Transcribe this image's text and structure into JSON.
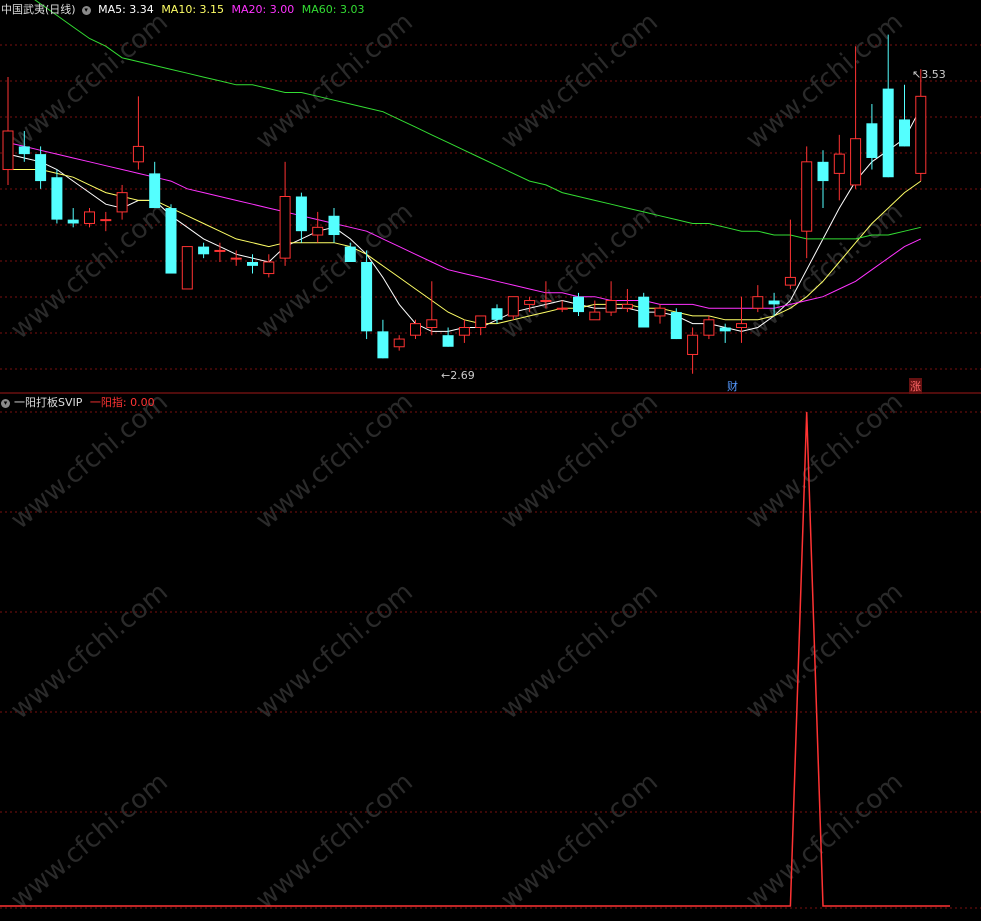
{
  "main_header": {
    "title": "中国武夷(日线)",
    "ma": [
      {
        "label": "MA5: 3.34",
        "color": "#ffffff"
      },
      {
        "label": "MA10: 3.15",
        "color": "#ffff66"
      },
      {
        "label": "MA20: 3.00",
        "color": "#ff33ff"
      },
      {
        "label": "MA60: 3.03",
        "color": "#33dd33"
      }
    ]
  },
  "sub_header": {
    "title": "一阳打板SVIP",
    "indicator": "一阳指: 0.00"
  },
  "annotations": {
    "high": "3.53",
    "low": "2.69",
    "event_cai": "财",
    "event_zhang": "涨"
  },
  "watermark": "www.cfchi.com",
  "colors": {
    "up": "#ff3333",
    "down": "#54ffff",
    "grid": "#7a1010",
    "ma5": "#ffffff",
    "ma10": "#ffff66",
    "ma20": "#ff33ff",
    "ma60": "#33dd33",
    "indicator": "#ff3333"
  },
  "chart_data": [
    {
      "type": "candlestick",
      "ylim": [
        2.6,
        3.62
      ],
      "candles": [
        {
          "o": 3.18,
          "h": 3.42,
          "l": 3.14,
          "c": 3.28
        },
        {
          "o": 3.24,
          "h": 3.28,
          "l": 3.2,
          "c": 3.22
        },
        {
          "o": 3.22,
          "h": 3.24,
          "l": 3.13,
          "c": 3.15
        },
        {
          "o": 3.16,
          "h": 3.18,
          "l": 3.04,
          "c": 3.05
        },
        {
          "o": 3.05,
          "h": 3.08,
          "l": 3.03,
          "c": 3.04
        },
        {
          "o": 3.04,
          "h": 3.08,
          "l": 3.03,
          "c": 3.07
        },
        {
          "o": 3.05,
          "h": 3.07,
          "l": 3.02,
          "c": 3.05
        },
        {
          "o": 3.07,
          "h": 3.14,
          "l": 3.05,
          "c": 3.12
        },
        {
          "o": 3.2,
          "h": 3.37,
          "l": 3.18,
          "c": 3.24
        },
        {
          "o": 3.17,
          "h": 3.2,
          "l": 3.08,
          "c": 3.08
        },
        {
          "o": 3.08,
          "h": 3.09,
          "l": 2.91,
          "c": 2.91
        },
        {
          "o": 2.87,
          "h": 2.98,
          "l": 2.87,
          "c": 2.98
        },
        {
          "o": 2.98,
          "h": 2.99,
          "l": 2.95,
          "c": 2.96
        },
        {
          "o": 2.97,
          "h": 2.99,
          "l": 2.94,
          "c": 2.97
        },
        {
          "o": 2.95,
          "h": 2.97,
          "l": 2.93,
          "c": 2.95
        },
        {
          "o": 2.94,
          "h": 2.96,
          "l": 2.91,
          "c": 2.93
        },
        {
          "o": 2.91,
          "h": 2.96,
          "l": 2.9,
          "c": 2.94
        },
        {
          "o": 2.95,
          "h": 3.2,
          "l": 2.93,
          "c": 3.11
        },
        {
          "o": 3.11,
          "h": 3.12,
          "l": 2.99,
          "c": 3.02
        },
        {
          "o": 3.01,
          "h": 3.07,
          "l": 2.99,
          "c": 3.03
        },
        {
          "o": 3.06,
          "h": 3.08,
          "l": 2.99,
          "c": 3.01
        },
        {
          "o": 2.98,
          "h": 2.99,
          "l": 2.94,
          "c": 2.94
        },
        {
          "o": 2.94,
          "h": 2.97,
          "l": 2.74,
          "c": 2.76
        },
        {
          "o": 2.76,
          "h": 2.79,
          "l": 2.69,
          "c": 2.69
        },
        {
          "o": 2.72,
          "h": 2.75,
          "l": 2.71,
          "c": 2.74
        },
        {
          "o": 2.75,
          "h": 2.79,
          "l": 2.74,
          "c": 2.78
        },
        {
          "o": 2.77,
          "h": 2.89,
          "l": 2.75,
          "c": 2.79
        },
        {
          "o": 2.75,
          "h": 2.77,
          "l": 2.72,
          "c": 2.72
        },
        {
          "o": 2.75,
          "h": 2.79,
          "l": 2.73,
          "c": 2.77
        },
        {
          "o": 2.77,
          "h": 2.8,
          "l": 2.75,
          "c": 2.8
        },
        {
          "o": 2.82,
          "h": 2.83,
          "l": 2.78,
          "c": 2.79
        },
        {
          "o": 2.8,
          "h": 2.85,
          "l": 2.79,
          "c": 2.85
        },
        {
          "o": 2.83,
          "h": 2.85,
          "l": 2.81,
          "c": 2.84
        },
        {
          "o": 2.84,
          "h": 2.89,
          "l": 2.82,
          "c": 2.84
        },
        {
          "o": 2.82,
          "h": 2.84,
          "l": 2.81,
          "c": 2.82
        },
        {
          "o": 2.85,
          "h": 2.86,
          "l": 2.8,
          "c": 2.81
        },
        {
          "o": 2.79,
          "h": 2.84,
          "l": 2.79,
          "c": 2.81
        },
        {
          "o": 2.81,
          "h": 2.89,
          "l": 2.8,
          "c": 2.84
        },
        {
          "o": 2.82,
          "h": 2.87,
          "l": 2.81,
          "c": 2.83
        },
        {
          "o": 2.85,
          "h": 2.86,
          "l": 2.77,
          "c": 2.77
        },
        {
          "o": 2.8,
          "h": 2.83,
          "l": 2.78,
          "c": 2.82
        },
        {
          "o": 2.81,
          "h": 2.82,
          "l": 2.74,
          "c": 2.74
        },
        {
          "o": 2.7,
          "h": 2.77,
          "l": 2.65,
          "c": 2.75
        },
        {
          "o": 2.75,
          "h": 2.8,
          "l": 2.74,
          "c": 2.79
        },
        {
          "o": 2.77,
          "h": 2.78,
          "l": 2.73,
          "c": 2.76
        },
        {
          "o": 2.77,
          "h": 2.85,
          "l": 2.73,
          "c": 2.78
        },
        {
          "o": 2.82,
          "h": 2.88,
          "l": 2.81,
          "c": 2.85
        },
        {
          "o": 2.84,
          "h": 2.86,
          "l": 2.8,
          "c": 2.83
        },
        {
          "o": 2.88,
          "h": 3.05,
          "l": 2.87,
          "c": 2.9
        },
        {
          "o": 3.02,
          "h": 3.24,
          "l": 2.95,
          "c": 3.2
        },
        {
          "o": 3.2,
          "h": 3.23,
          "l": 3.08,
          "c": 3.15
        },
        {
          "o": 3.17,
          "h": 3.27,
          "l": 3.1,
          "c": 3.22
        },
        {
          "o": 3.14,
          "h": 3.5,
          "l": 3.13,
          "c": 3.26
        },
        {
          "o": 3.3,
          "h": 3.35,
          "l": 3.18,
          "c": 3.21
        },
        {
          "o": 3.39,
          "h": 3.53,
          "l": 3.16,
          "c": 3.16
        },
        {
          "o": 3.31,
          "h": 3.4,
          "l": 3.24,
          "c": 3.24
        },
        {
          "o": 3.17,
          "h": 3.44,
          "l": 3.15,
          "c": 3.37
        }
      ],
      "series": [
        {
          "name": "MA5",
          "values": [
            3.22,
            3.21,
            3.2,
            3.18,
            3.15,
            3.12,
            3.09,
            3.08,
            3.1,
            3.1,
            3.06,
            3.03,
            3.0,
            2.98,
            2.96,
            2.95,
            2.94,
            2.98,
            3.0,
            3.02,
            3.03,
            3.0,
            2.96,
            2.9,
            2.83,
            2.78,
            2.76,
            2.76,
            2.77,
            2.77,
            2.79,
            2.81,
            2.82,
            2.83,
            2.84,
            2.83,
            2.82,
            2.82,
            2.82,
            2.81,
            2.81,
            2.8,
            2.78,
            2.78,
            2.77,
            2.76,
            2.77,
            2.8,
            2.84,
            2.92,
            3.0,
            3.08,
            3.15,
            3.2,
            3.23,
            3.26,
            3.34
          ]
        },
        {
          "name": "MA10",
          "values": [
            3.18,
            3.18,
            3.18,
            3.17,
            3.16,
            3.14,
            3.12,
            3.11,
            3.1,
            3.1,
            3.08,
            3.06,
            3.04,
            3.02,
            3.0,
            2.99,
            2.98,
            2.99,
            2.99,
            2.99,
            2.99,
            2.98,
            2.96,
            2.93,
            2.9,
            2.87,
            2.84,
            2.81,
            2.79,
            2.78,
            2.78,
            2.79,
            2.8,
            2.81,
            2.82,
            2.82,
            2.83,
            2.83,
            2.83,
            2.82,
            2.82,
            2.81,
            2.8,
            2.8,
            2.79,
            2.79,
            2.79,
            2.8,
            2.82,
            2.85,
            2.89,
            2.94,
            2.99,
            3.04,
            3.08,
            3.12,
            3.15
          ]
        },
        {
          "name": "MA20",
          "values": [
            3.25,
            3.24,
            3.23,
            3.22,
            3.21,
            3.2,
            3.19,
            3.18,
            3.17,
            3.16,
            3.15,
            3.13,
            3.12,
            3.11,
            3.1,
            3.09,
            3.08,
            3.07,
            3.06,
            3.05,
            3.04,
            3.03,
            3.02,
            3.0,
            2.98,
            2.96,
            2.94,
            2.92,
            2.91,
            2.9,
            2.89,
            2.88,
            2.87,
            2.86,
            2.86,
            2.85,
            2.85,
            2.84,
            2.84,
            2.84,
            2.83,
            2.83,
            2.83,
            2.82,
            2.82,
            2.82,
            2.82,
            2.82,
            2.83,
            2.84,
            2.85,
            2.87,
            2.89,
            2.92,
            2.95,
            2.98,
            3.0
          ]
        },
        {
          "name": "MA60",
          "values": [
            3.66,
            3.64,
            3.61,
            3.58,
            3.55,
            3.52,
            3.5,
            3.47,
            3.46,
            3.45,
            3.44,
            3.43,
            3.42,
            3.41,
            3.4,
            3.4,
            3.39,
            3.38,
            3.38,
            3.37,
            3.36,
            3.35,
            3.34,
            3.33,
            3.31,
            3.29,
            3.27,
            3.25,
            3.23,
            3.21,
            3.19,
            3.17,
            3.15,
            3.14,
            3.12,
            3.11,
            3.1,
            3.09,
            3.08,
            3.07,
            3.06,
            3.05,
            3.04,
            3.04,
            3.03,
            3.02,
            3.02,
            3.01,
            3.01,
            3.0,
            3.0,
            3.0,
            3.0,
            3.01,
            3.01,
            3.02,
            3.03
          ]
        }
      ]
    },
    {
      "type": "line",
      "series": [
        {
          "name": "一阳指",
          "values": [
            0,
            0,
            0,
            0,
            0,
            0,
            0,
            0,
            0,
            0,
            0,
            0,
            0,
            0,
            0,
            0,
            0,
            0,
            0,
            0,
            0,
            0,
            0,
            0,
            0,
            0,
            0,
            0,
            0,
            0,
            0,
            0,
            0,
            0,
            0,
            0,
            0,
            0,
            0,
            0,
            0,
            0,
            0,
            0,
            0,
            0,
            0,
            0,
            0,
            1,
            0,
            0,
            0,
            0,
            0,
            0,
            0
          ]
        }
      ]
    }
  ]
}
